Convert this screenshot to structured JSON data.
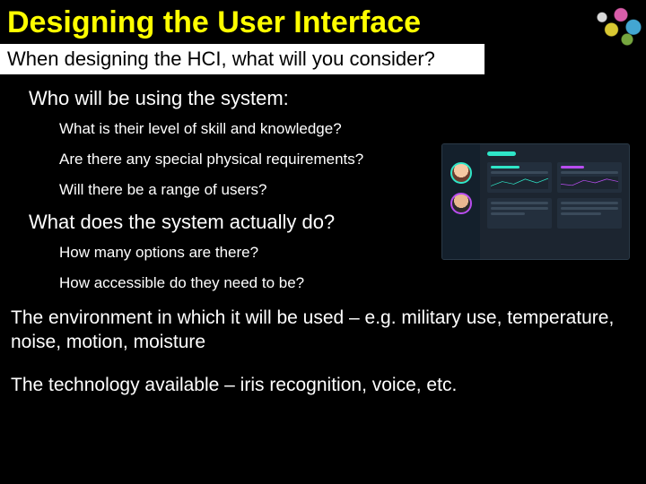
{
  "title": "Designing the User Interface",
  "subtitle": "When designing the HCI, what will you consider?",
  "sections": {
    "who": {
      "heading": "Who will be using the system:",
      "items": [
        "What is their level of skill and knowledge?",
        "Are there any special physical requirements?",
        "Will there be a range of users?"
      ]
    },
    "what": {
      "heading": "What does the system actually do?",
      "items": [
        "How many options are there?",
        "How accessible do they need to be?"
      ]
    }
  },
  "environment_text": "The environment in which it will be used – e.g. military use, temperature, noise, motion, moisture",
  "technology_text": "The technology available – iris recognition, voice, etc."
}
